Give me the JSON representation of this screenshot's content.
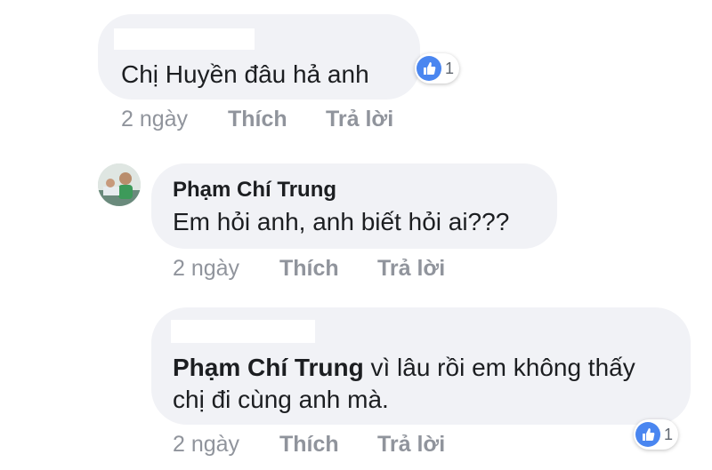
{
  "comment1": {
    "text": "Chị  Huyền đâu hả anh",
    "reaction_count": "1",
    "age": "2 ngày",
    "like_label": "Thích",
    "reply_label": "Trả lời"
  },
  "comment2": {
    "author": "Phạm Chí Trung",
    "text": "Em hỏi anh, anh biết hỏi ai???",
    "age": "2 ngày",
    "like_label": "Thích",
    "reply_label": "Trả lời"
  },
  "comment3": {
    "mention": "Phạm Chí Trung",
    "text_line1": " vì lâu rồi em không thấy",
    "text_line2": "chị đi cùng anh mà.",
    "reaction_count": "1",
    "age": "2 ngày",
    "like_label": "Thích",
    "reply_label": "Trả lời"
  },
  "colors": {
    "bubble": "#f1f2f6",
    "like_blue": "#4a86f0",
    "meta_gray": "#90949c",
    "text": "#1c1e21"
  }
}
